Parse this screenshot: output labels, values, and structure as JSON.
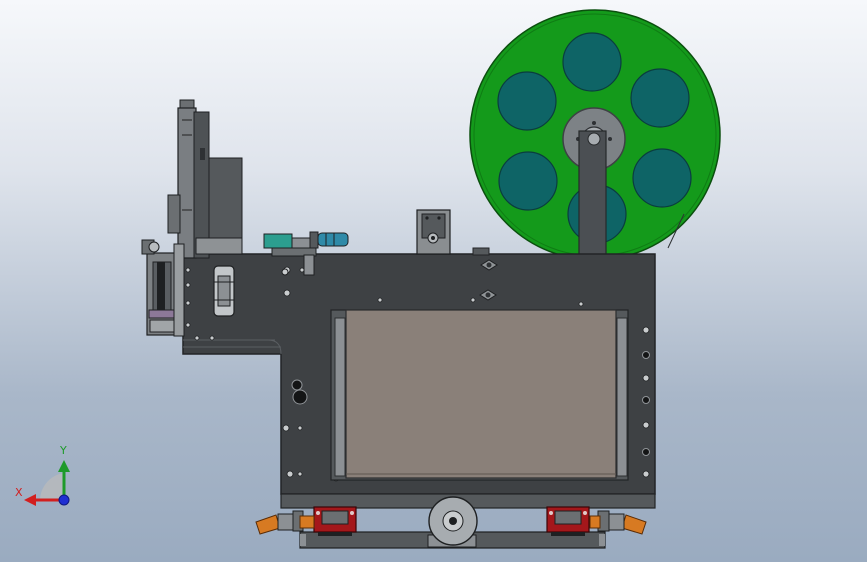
{
  "viewport": {
    "background_top": "#f6f8fb",
    "background_bottom": "#9aabc0"
  },
  "triad": {
    "x_label": "X",
    "y_label": "Y",
    "x_color": "#d21f1f",
    "y_color": "#1e9a2a",
    "z_color": "#1f2fd2"
  },
  "model": {
    "frame_color": "#3e4144",
    "panel_color": "#8a8079",
    "reel_color": "#149a1b",
    "reel_hole_color": "#0e6466",
    "rail_block_color": "#a4171b",
    "hinge_color": "#d77a22",
    "valve_color": "#2f8aa8"
  }
}
